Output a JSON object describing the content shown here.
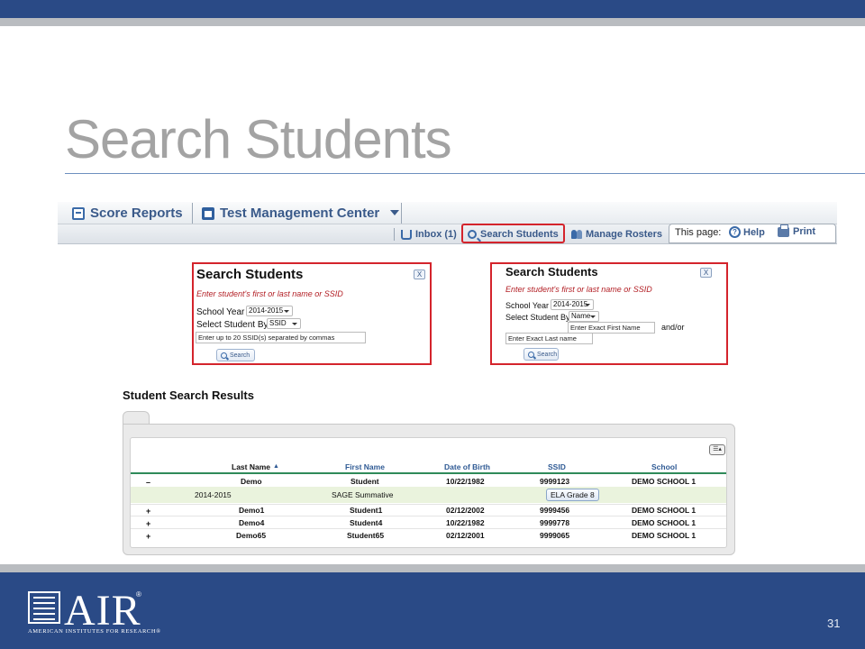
{
  "slide": {
    "title": "Search Students",
    "page_number": "31"
  },
  "app": {
    "nav": {
      "score_reports": "Score Reports",
      "test_management_center": "Test Management Center"
    },
    "subnav": {
      "inbox": "Inbox (1)",
      "search_students": "Search Students",
      "manage_rosters": "Manage Rosters",
      "this_page": "This page:",
      "help": "Help",
      "print": "Print"
    }
  },
  "panel_ssid": {
    "title": "Search Students",
    "close": "X",
    "instruction": "Enter student's first or last name or SSID",
    "school_year_label": "School Year",
    "school_year_value": "2014-2015",
    "select_by_label": "Select Student By",
    "select_by_value": "SSID",
    "ssid_placeholder": "Enter up to 20 SSID(s) separated by commas",
    "search_button": "Search"
  },
  "panel_name": {
    "title": "Search Students",
    "close": "X",
    "instruction": "Enter student's first or last name or SSID",
    "school_year_label": "School Year",
    "school_year_value": "2014-2015",
    "select_by_label": "Select Student By",
    "select_by_value": "Name",
    "first_name_placeholder": "Enter Exact First Name",
    "andor": "and/or",
    "last_name_placeholder": "Enter Exact Last name",
    "search_button": "Search"
  },
  "results": {
    "title": "Student Search Results",
    "columns": [
      "Last Name",
      "First Name",
      "Date of Birth",
      "SSID",
      "School"
    ],
    "expanded_row": {
      "sign": "–",
      "last_name": "Demo",
      "first_name": "Student",
      "dob": "10/22/1982",
      "ssid": "9999123",
      "school": "DEMO SCHOOL 1"
    },
    "detail": {
      "year": "2014-2015",
      "test": "SAGE Summative",
      "grade_button": "ELA Grade 8"
    },
    "rows": [
      {
        "sign": "+",
        "last_name": "Demo1",
        "first_name": "Student1",
        "dob": "02/12/2002",
        "ssid": "9999456",
        "school": "DEMO SCHOOL 1"
      },
      {
        "sign": "+",
        "last_name": "Demo4",
        "first_name": "Student4",
        "dob": "10/22/1982",
        "ssid": "9999778",
        "school": "DEMO SCHOOL 1"
      },
      {
        "sign": "+",
        "last_name": "Demo65",
        "first_name": "Student65",
        "dob": "02/12/2001",
        "ssid": "9999065",
        "school": "DEMO SCHOOL 1"
      }
    ]
  },
  "footer": {
    "logo_text": "AIR",
    "logo_reg": "®",
    "logo_sub": "AMERICAN INSTITUTES FOR RESEARCH®"
  },
  "colors": {
    "brand_blue": "#2a4a86",
    "highlight_red": "#d4242c",
    "title_gray": "#a3a3a3",
    "header_rule_green": "#2f8a5a"
  }
}
